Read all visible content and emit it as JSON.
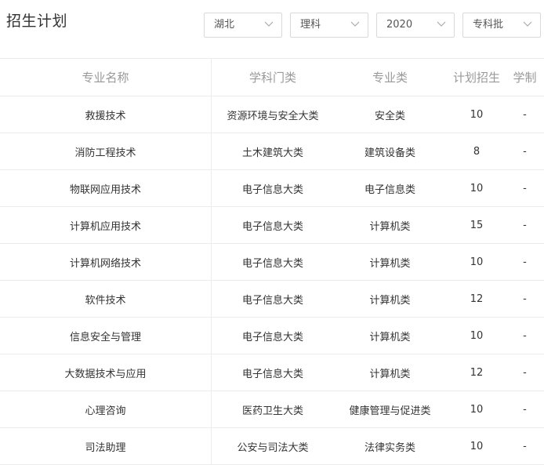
{
  "title": "招生计划",
  "filters": {
    "province": "湖北",
    "subject": "理科",
    "year": "2020",
    "batch": "专科批"
  },
  "table": {
    "headers": [
      "专业名称",
      "学科门类",
      "专业类",
      "计划招生",
      "学制"
    ],
    "rows": [
      [
        "救援技术",
        "资源环境与安全大类",
        "安全类",
        "10",
        "-"
      ],
      [
        "消防工程技术",
        "土木建筑大类",
        "建筑设备类",
        "8",
        "-"
      ],
      [
        "物联网应用技术",
        "电子信息大类",
        "电子信息类",
        "10",
        "-"
      ],
      [
        "计算机应用技术",
        "电子信息大类",
        "计算机类",
        "15",
        "-"
      ],
      [
        "计算机网络技术",
        "电子信息大类",
        "计算机类",
        "10",
        "-"
      ],
      [
        "软件技术",
        "电子信息大类",
        "计算机类",
        "12",
        "-"
      ],
      [
        "信息安全与管理",
        "电子信息大类",
        "计算机类",
        "10",
        "-"
      ],
      [
        "大数据技术与应用",
        "电子信息大类",
        "计算机类",
        "12",
        "-"
      ],
      [
        "心理咨询",
        "医药卫生大类",
        "健康管理与促进类",
        "10",
        "-"
      ],
      [
        "司法助理",
        "公安与司法大类",
        "法律实务类",
        "10",
        "-"
      ]
    ]
  },
  "icons": {
    "select_chevron": "chevron-down-icon"
  },
  "colors": {
    "header_text": "#999999",
    "border": "#ececec"
  }
}
